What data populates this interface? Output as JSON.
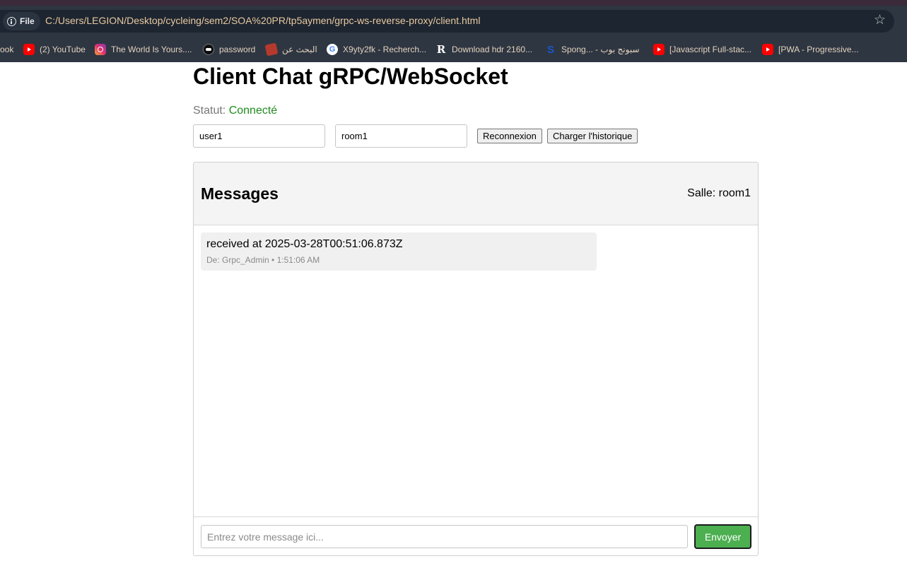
{
  "browser": {
    "file_chip": "File",
    "url": "C:/Users/LEGION/Desktop/cycleing/sem2/SOA%20PR/tp5aymen/grpc-ws-reverse-proxy/client.html",
    "star_icon": "star-icon",
    "bookmarks": [
      {
        "label": "ook",
        "icon": "none"
      },
      {
        "label": "(2) YouTube",
        "icon": "youtube-icon"
      },
      {
        "label": "The World Is Yours....",
        "icon": "instagram-icon"
      },
      {
        "label": "password",
        "icon": "password-bot-icon"
      },
      {
        "label": "البحث عن",
        "icon": "arabic-site-icon"
      },
      {
        "label": "X9yty2fk - Recherch...",
        "icon": "google-icon"
      },
      {
        "label": "Download hdr 2160...",
        "icon": "r-site-icon"
      },
      {
        "label": "Spong... - سبونج بوب",
        "icon": "s-site-icon"
      },
      {
        "label": "[Javascript Full-stac...",
        "icon": "youtube-icon"
      },
      {
        "label": "[PWA - Progressive...",
        "icon": "youtube-icon"
      }
    ]
  },
  "page": {
    "title": "Client Chat gRPC/WebSocket",
    "status_label": "Statut:",
    "status_value": "Connecté",
    "status_color": "#1f8a1f",
    "user_value": "user1",
    "room_value": "room1",
    "reconnect_label": "Reconnexion",
    "history_label": "Charger l'historique"
  },
  "chat": {
    "title": "Messages",
    "room_label": "Salle: room1",
    "messages": [
      {
        "text": "received at 2025-03-28T00:51:06.873Z",
        "meta": "De: Grpc_Admin • 1:51:06 AM"
      }
    ],
    "input_placeholder": "Entrez votre message ici...",
    "send_label": "Envoyer",
    "send_color": "#4caf50"
  }
}
